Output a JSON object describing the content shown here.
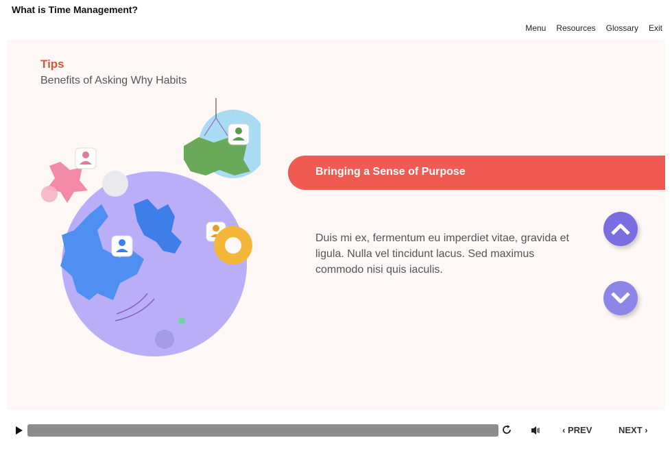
{
  "header": {
    "course_title": "What is Time Management?",
    "nav": [
      "Menu",
      "Resources",
      "Glossary",
      "Exit"
    ]
  },
  "slide": {
    "label": "Tips",
    "subtitle": "Benefits of Asking Why Habits",
    "banner": "Bringing a Sense of Purpose",
    "body": "Duis mi ex, fermentum eu imperdiet vitae, gravida et ligula. Nulla vel tincidunt lacus. Sed maximus commodo nisi quis iaculis."
  },
  "player": {
    "prev_label": "PREV",
    "next_label": "NEXT"
  },
  "colors": {
    "accent": "#e0533b",
    "banner": "#ef5a52",
    "nav_circle": "#7b6ee0",
    "slide_bg": "#fdf7f5"
  },
  "icons": [
    "play-icon",
    "replay-icon",
    "volume-icon",
    "chevron-left-icon",
    "chevron-right-icon",
    "chevron-up-icon",
    "chevron-down-icon"
  ]
}
